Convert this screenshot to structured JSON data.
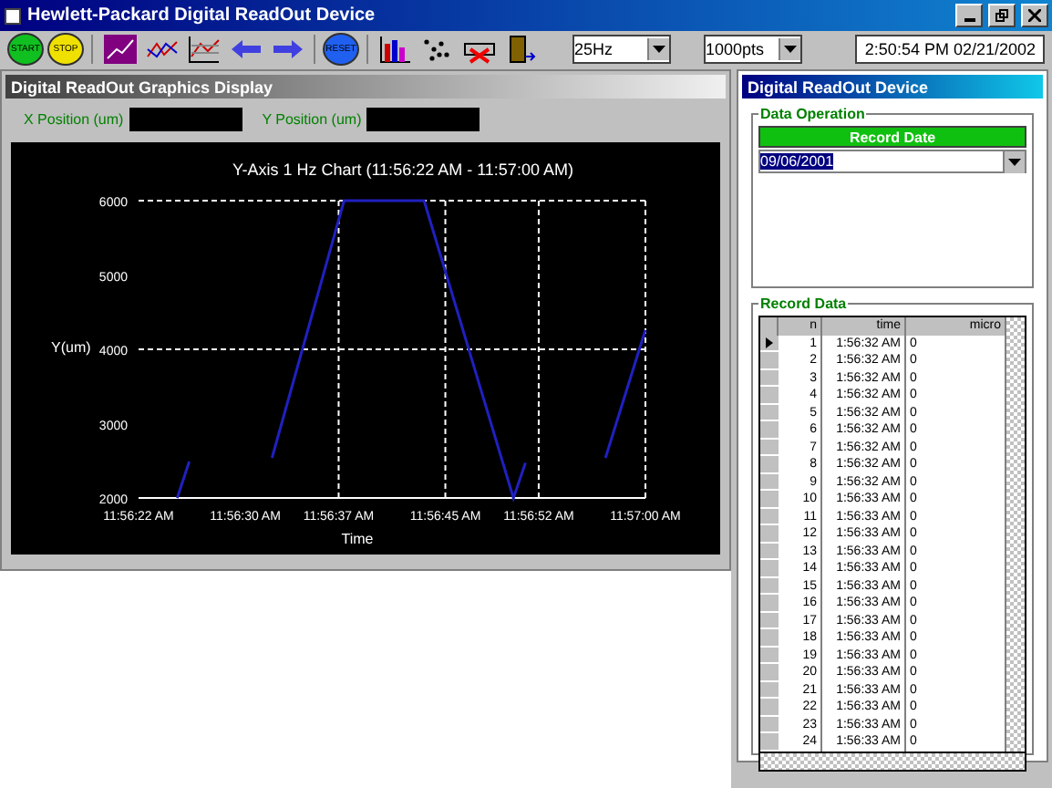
{
  "window": {
    "title": "Hewlett-Packard Digital ReadOut Device"
  },
  "toolbar": {
    "buttons": [
      {
        "kind": "circle",
        "label": "START",
        "color": "#10c020"
      },
      {
        "kind": "circle",
        "label": "STOP",
        "color": "#f0e000"
      },
      {
        "kind": "icon"
      },
      {
        "kind": "icon"
      },
      {
        "kind": "icon"
      },
      {
        "kind": "icon"
      },
      {
        "kind": "icon"
      },
      {
        "kind": "circle",
        "label": "RESET",
        "color": "#2060f0"
      },
      {
        "kind": "icon"
      },
      {
        "kind": "icon"
      },
      {
        "kind": "icon"
      },
      {
        "kind": "icon"
      }
    ],
    "rate": "25Hz",
    "points": "1000pts",
    "clock": "2:50:54 PM    02/21/2002"
  },
  "graphics_panel": {
    "title": "Digital ReadOut Graphics Display",
    "x_position_label": "X Position (um)",
    "y_position_label": "Y Position (um)",
    "chart_data": {
      "type": "line",
      "title": "Y-Axis 1 Hz Chart (11:56:22 AM - 11:57:00 AM)",
      "xlabel": "Time",
      "ylabel": "Y(um)",
      "x": [
        42984.9,
        42985.8,
        null,
        42992,
        42997.4,
        43003.4,
        43010.1,
        43011,
        null,
        43017,
        43020
      ],
      "series": [
        {
          "color": "#2020c0",
          "values": [
            2000,
            2490,
            null,
            2540,
            6000,
            6000,
            2000,
            2470,
            null,
            2540,
            4260
          ]
        }
      ],
      "grid": true,
      "xlim": [
        42982,
        43020
      ],
      "ylim": [
        2000,
        6000
      ],
      "xticks": [
        {
          "value": 42982,
          "label": "11:56:22 AM"
        },
        {
          "value": 42990,
          "label": "11:56:30 AM"
        },
        {
          "value": 42997,
          "label": "11:56:37 AM"
        },
        {
          "value": 43005,
          "label": "11:56:45 AM"
        },
        {
          "value": 43012,
          "label": "11:56:52 AM"
        },
        {
          "value": 43020,
          "label": "11:57:00 AM"
        }
      ],
      "yticks": [
        2000,
        3000,
        4000,
        5000,
        6000
      ]
    }
  },
  "device_panel": {
    "title": "Digital ReadOut Device",
    "data_operation": {
      "title": "Data Operation",
      "button": "Record Date",
      "date": "09/06/2001"
    },
    "record_data": {
      "title": "Record Data",
      "columns": [
        "n",
        "time",
        "micro"
      ],
      "rows": [
        {
          "n": "1",
          "time": "1:56:32 AM",
          "value": "0",
          "selected": true
        },
        {
          "n": "2",
          "time": "1:56:32 AM",
          "value": "0",
          "selected": false
        },
        {
          "n": "3",
          "time": "1:56:32 AM",
          "value": "0",
          "selected": false
        },
        {
          "n": "4",
          "time": "1:56:32 AM",
          "value": "0",
          "selected": false
        },
        {
          "n": "5",
          "time": "1:56:32 AM",
          "value": "0",
          "selected": false
        },
        {
          "n": "6",
          "time": "1:56:32 AM",
          "value": "0",
          "selected": false
        },
        {
          "n": "7",
          "time": "1:56:32 AM",
          "value": "0",
          "selected": false
        },
        {
          "n": "8",
          "time": "1:56:32 AM",
          "value": "0",
          "selected": false
        },
        {
          "n": "9",
          "time": "1:56:32 AM",
          "value": "0",
          "selected": false
        },
        {
          "n": "10",
          "time": "1:56:33 AM",
          "value": "0",
          "selected": false
        },
        {
          "n": "11",
          "time": "1:56:33 AM",
          "value": "0",
          "selected": false
        },
        {
          "n": "12",
          "time": "1:56:33 AM",
          "value": "0",
          "selected": false
        },
        {
          "n": "13",
          "time": "1:56:33 AM",
          "value": "0",
          "selected": false
        },
        {
          "n": "14",
          "time": "1:56:33 AM",
          "value": "0",
          "selected": false
        },
        {
          "n": "15",
          "time": "1:56:33 AM",
          "value": "0",
          "selected": false
        },
        {
          "n": "16",
          "time": "1:56:33 AM",
          "value": "0",
          "selected": false
        },
        {
          "n": "17",
          "time": "1:56:33 AM",
          "value": "0",
          "selected": false
        },
        {
          "n": "18",
          "time": "1:56:33 AM",
          "value": "0",
          "selected": false
        },
        {
          "n": "19",
          "time": "1:56:33 AM",
          "value": "0",
          "selected": false
        },
        {
          "n": "20",
          "time": "1:56:33 AM",
          "value": "0",
          "selected": false
        },
        {
          "n": "21",
          "time": "1:56:33 AM",
          "value": "0",
          "selected": false
        },
        {
          "n": "22",
          "time": "1:56:33 AM",
          "value": "0",
          "selected": false
        },
        {
          "n": "23",
          "time": "1:56:33 AM",
          "value": "0",
          "selected": false
        },
        {
          "n": "24",
          "time": "1:56:33 AM",
          "value": "0",
          "selected": false
        }
      ]
    }
  }
}
